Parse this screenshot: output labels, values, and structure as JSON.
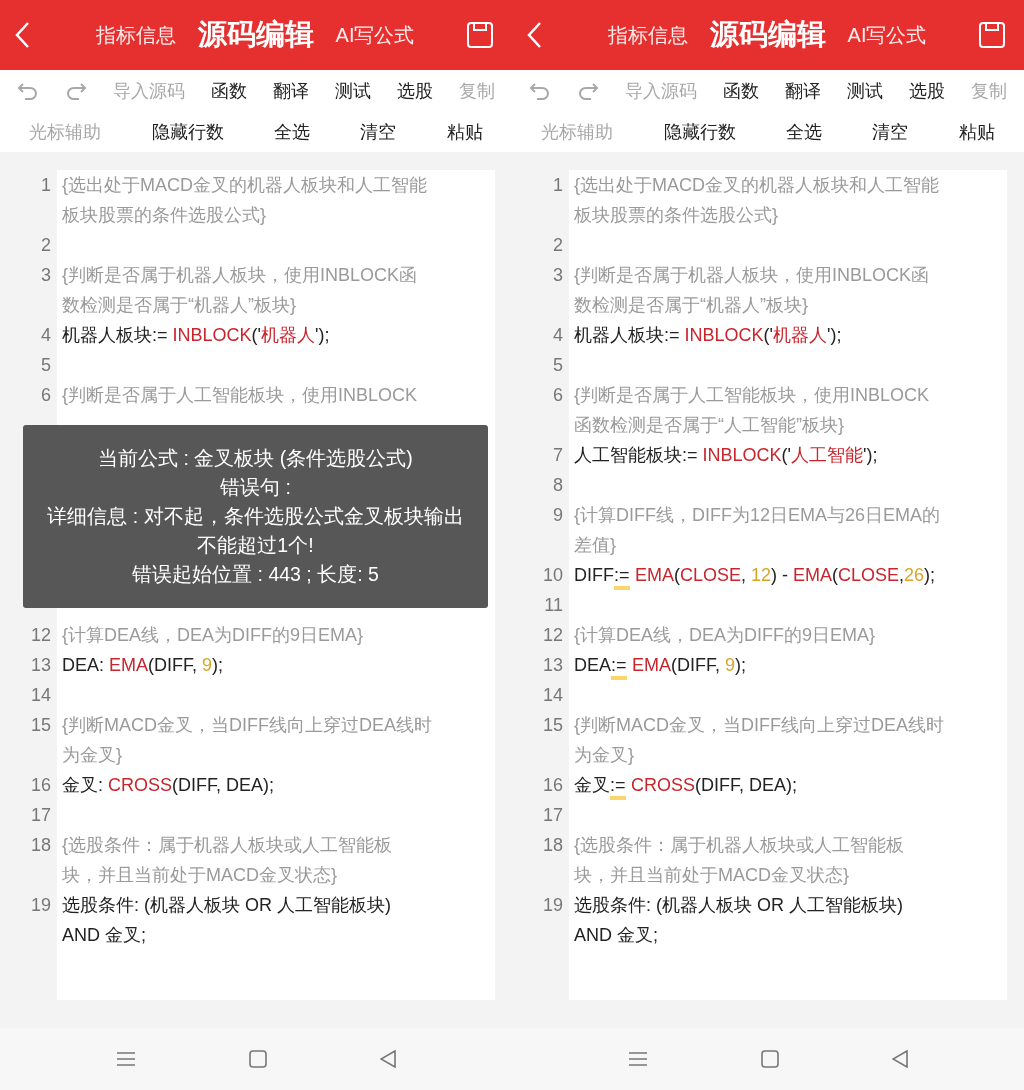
{
  "screens": [
    {
      "header": {
        "tabs": [
          {
            "label": "指标信息",
            "selected": false
          },
          {
            "label": "源码编辑",
            "selected": true
          },
          {
            "label": "AI写公式",
            "selected": false
          }
        ]
      },
      "toolbar": {
        "rows": [
          {
            "items": [
              {
                "kind": "undo",
                "disabled": true
              },
              {
                "kind": "redo",
                "disabled": true
              },
              {
                "kind": "text",
                "label": "导入源码",
                "disabled": true
              },
              {
                "kind": "text",
                "label": "函数",
                "disabled": false
              },
              {
                "kind": "text",
                "label": "翻译",
                "disabled": false
              },
              {
                "kind": "text",
                "label": "测试",
                "disabled": false
              },
              {
                "kind": "text",
                "label": "选股",
                "disabled": false
              },
              {
                "kind": "text",
                "label": "复制",
                "disabled": true
              }
            ]
          },
          {
            "items": [
              {
                "kind": "text",
                "label": "光标辅助",
                "disabled": true
              },
              {
                "kind": "text",
                "label": "隐藏行数",
                "disabled": false
              },
              {
                "kind": "text",
                "label": "全选",
                "disabled": false
              },
              {
                "kind": "text",
                "label": "清空",
                "disabled": false
              },
              {
                "kind": "text",
                "label": "粘贴",
                "disabled": false
              }
            ]
          }
        ]
      },
      "code": {
        "items": [
          {
            "kind": "line",
            "number": "1",
            "rows": [
              [
                {
                  "kind": "comment",
                  "text": "{选出处于MACD金叉的机器人板块和人工智能"
                }
              ],
              [
                {
                  "kind": "comment",
                  "text": "板块股票的条件选股公式}"
                }
              ]
            ]
          },
          {
            "kind": "line",
            "number": "2"
          },
          {
            "kind": "line",
            "number": "3",
            "rows": [
              [
                {
                  "kind": "comment",
                  "text": "{判断是否属于机器人板块，使用INBLOCK函"
                }
              ],
              [
                {
                  "kind": "comment",
                  "text": "数检测是否属于“机器人”板块}"
                }
              ]
            ]
          },
          {
            "kind": "line",
            "number": "4",
            "rows": [
              [
                {
                  "kind": "plain",
                  "text": "机器人板块:= "
                },
                {
                  "kind": "func",
                  "text": "INBLOCK"
                },
                {
                  "kind": "plain",
                  "text": "('"
                },
                {
                  "kind": "str",
                  "text": "机器人"
                },
                {
                  "kind": "plain",
                  "text": "');"
                }
              ]
            ]
          },
          {
            "kind": "line",
            "number": "5"
          },
          {
            "kind": "line",
            "number": "6",
            "rows": [
              [
                {
                  "kind": "comment",
                  "text": "{判断是否属于人工智能板块，使用INBLOCK"
                }
              ]
            ]
          },
          {
            "kind": "toast",
            "lines": [
              "当前公式 : 金叉板块 (条件选股公式)",
              "错误句 :",
              "详细信息 : 对不起，条件选股公式金叉板块输出不能超过1个!",
              "错误起始位置 : 443 ; 长度: 5"
            ]
          },
          {
            "kind": "line",
            "number": "12",
            "rows": [
              [
                {
                  "kind": "comment",
                  "text": "{计算DEA线，DEA为DIFF的9日EMA}"
                }
              ]
            ]
          },
          {
            "kind": "line",
            "number": "13",
            "rows": [
              [
                {
                  "kind": "plain",
                  "text": "DEA: "
                },
                {
                  "kind": "func",
                  "text": "EMA"
                },
                {
                  "kind": "plain",
                  "text": "(DIFF, "
                },
                {
                  "kind": "num",
                  "text": "9"
                },
                {
                  "kind": "plain",
                  "text": ");"
                }
              ]
            ]
          },
          {
            "kind": "line",
            "number": "14"
          },
          {
            "kind": "line",
            "number": "15",
            "rows": [
              [
                {
                  "kind": "comment",
                  "text": "{判断MACD金叉，当DIFF线向上穿过DEA线时"
                }
              ],
              [
                {
                  "kind": "comment",
                  "text": "为金叉}"
                }
              ]
            ]
          },
          {
            "kind": "line",
            "number": "16",
            "rows": [
              [
                {
                  "kind": "plain",
                  "text": "金叉: "
                },
                {
                  "kind": "func",
                  "text": "CROSS"
                },
                {
                  "kind": "plain",
                  "text": "(DIFF, DEA);"
                }
              ]
            ]
          },
          {
            "kind": "line",
            "number": "17"
          },
          {
            "kind": "line",
            "number": "18",
            "rows": [
              [
                {
                  "kind": "comment",
                  "text": "{选股条件：属于机器人板块或人工智能板"
                }
              ],
              [
                {
                  "kind": "comment",
                  "text": "块，并且当前处于MACD金叉状态}"
                }
              ]
            ]
          },
          {
            "kind": "line",
            "number": "19",
            "rows": [
              [
                {
                  "kind": "plain",
                  "text": "选股条件: (机器人板块 OR 人工智能板块)"
                }
              ],
              [
                {
                  "kind": "plain",
                  "text": "AND 金叉;"
                }
              ]
            ]
          }
        ]
      }
    },
    {
      "header": {
        "tabs": [
          {
            "label": "指标信息",
            "selected": false
          },
          {
            "label": "源码编辑",
            "selected": true
          },
          {
            "label": "AI写公式",
            "selected": false
          }
        ]
      },
      "toolbar": {
        "rows": [
          {
            "items": [
              {
                "kind": "undo",
                "disabled": true
              },
              {
                "kind": "redo",
                "disabled": true
              },
              {
                "kind": "text",
                "label": "导入源码",
                "disabled": true
              },
              {
                "kind": "text",
                "label": "函数",
                "disabled": false
              },
              {
                "kind": "text",
                "label": "翻译",
                "disabled": false
              },
              {
                "kind": "text",
                "label": "测试",
                "disabled": false
              },
              {
                "kind": "text",
                "label": "选股",
                "disabled": false
              },
              {
                "kind": "text",
                "label": "复制",
                "disabled": true
              }
            ]
          },
          {
            "items": [
              {
                "kind": "text",
                "label": "光标辅助",
                "disabled": true
              },
              {
                "kind": "text",
                "label": "隐藏行数",
                "disabled": false
              },
              {
                "kind": "text",
                "label": "全选",
                "disabled": false
              },
              {
                "kind": "text",
                "label": "清空",
                "disabled": false
              },
              {
                "kind": "text",
                "label": "粘贴",
                "disabled": false
              }
            ]
          }
        ]
      },
      "code": {
        "items": [
          {
            "kind": "line",
            "number": "1",
            "rows": [
              [
                {
                  "kind": "comment",
                  "text": "{选出处于MACD金叉的机器人板块和人工智能"
                }
              ],
              [
                {
                  "kind": "comment",
                  "text": "板块股票的条件选股公式}"
                }
              ]
            ]
          },
          {
            "kind": "line",
            "number": "2"
          },
          {
            "kind": "line",
            "number": "3",
            "rows": [
              [
                {
                  "kind": "comment",
                  "text": "{判断是否属于机器人板块，使用INBLOCK函"
                }
              ],
              [
                {
                  "kind": "comment",
                  "text": "数检测是否属于“机器人”板块}"
                }
              ]
            ]
          },
          {
            "kind": "line",
            "number": "4",
            "rows": [
              [
                {
                  "kind": "plain",
                  "text": "机器人板块:= "
                },
                {
                  "kind": "func",
                  "text": "INBLOCK"
                },
                {
                  "kind": "plain",
                  "text": "('"
                },
                {
                  "kind": "str",
                  "text": "机器人"
                },
                {
                  "kind": "plain",
                  "text": "');"
                }
              ]
            ]
          },
          {
            "kind": "line",
            "number": "5"
          },
          {
            "kind": "line",
            "number": "6",
            "rows": [
              [
                {
                  "kind": "comment",
                  "text": "{判断是否属于人工智能板块，使用INBLOCK"
                }
              ],
              [
                {
                  "kind": "comment",
                  "text": "函数检测是否属于“人工智能”板块}"
                }
              ]
            ]
          },
          {
            "kind": "line",
            "number": "7",
            "rows": [
              [
                {
                  "kind": "plain",
                  "text": "人工智能板块:= "
                },
                {
                  "kind": "func",
                  "text": "INBLOCK"
                },
                {
                  "kind": "plain",
                  "text": "('"
                },
                {
                  "kind": "str",
                  "text": "人工智能"
                },
                {
                  "kind": "plain",
                  "text": "');"
                }
              ]
            ]
          },
          {
            "kind": "line",
            "number": "8"
          },
          {
            "kind": "line",
            "number": "9",
            "rows": [
              [
                {
                  "kind": "comment",
                  "text": "{计算DIFF线，DIFF为12日EMA与26日EMA的"
                }
              ],
              [
                {
                  "kind": "comment",
                  "text": "差值}"
                }
              ]
            ]
          },
          {
            "kind": "line",
            "number": "10",
            "rows": [
              [
                {
                  "kind": "plain",
                  "text": "DIFF"
                },
                {
                  "kind": "plain",
                  "text": ":=",
                  "highlight": true
                },
                {
                  "kind": "func",
                  "text": "EMA"
                },
                {
                  "kind": "plain",
                  "text": "("
                },
                {
                  "kind": "func",
                  "text": "CLOSE"
                },
                {
                  "kind": "plain",
                  "text": ", "
                },
                {
                  "kind": "num",
                  "text": "12"
                },
                {
                  "kind": "plain",
                  "text": ") - "
                },
                {
                  "kind": "func",
                  "text": "EMA"
                },
                {
                  "kind": "plain",
                  "text": "("
                },
                {
                  "kind": "func",
                  "text": "CLOSE"
                },
                {
                  "kind": "plain",
                  "text": ","
                },
                {
                  "kind": "num",
                  "text": "26"
                },
                {
                  "kind": "plain",
                  "text": ");"
                }
              ]
            ]
          },
          {
            "kind": "line",
            "number": "11"
          },
          {
            "kind": "line",
            "number": "12",
            "rows": [
              [
                {
                  "kind": "comment",
                  "text": "{计算DEA线，DEA为DIFF的9日EMA}"
                }
              ]
            ]
          },
          {
            "kind": "line",
            "number": "13",
            "rows": [
              [
                {
                  "kind": "plain",
                  "text": "DEA"
                },
                {
                  "kind": "plain",
                  "text": ":=",
                  "highlight": true
                },
                {
                  "kind": "func",
                  "text": "EMA"
                },
                {
                  "kind": "plain",
                  "text": "(DIFF, "
                },
                {
                  "kind": "num",
                  "text": "9"
                },
                {
                  "kind": "plain",
                  "text": ");"
                }
              ]
            ]
          },
          {
            "kind": "line",
            "number": "14"
          },
          {
            "kind": "line",
            "number": "15",
            "rows": [
              [
                {
                  "kind": "comment",
                  "text": "{判断MACD金叉，当DIFF线向上穿过DEA线时"
                }
              ],
              [
                {
                  "kind": "comment",
                  "text": "为金叉}"
                }
              ]
            ]
          },
          {
            "kind": "line",
            "number": "16",
            "rows": [
              [
                {
                  "kind": "plain",
                  "text": "金叉"
                },
                {
                  "kind": "plain",
                  "text": ":=",
                  "highlight": true
                },
                {
                  "kind": "func",
                  "text": "CROSS"
                },
                {
                  "kind": "plain",
                  "text": "(DIFF, DEA);"
                }
              ]
            ]
          },
          {
            "kind": "line",
            "number": "17"
          },
          {
            "kind": "line",
            "number": "18",
            "rows": [
              [
                {
                  "kind": "comment",
                  "text": "{选股条件：属于机器人板块或人工智能板"
                }
              ],
              [
                {
                  "kind": "comment",
                  "text": "块，并且当前处于MACD金叉状态}"
                }
              ]
            ]
          },
          {
            "kind": "line",
            "number": "19",
            "rows": [
              [
                {
                  "kind": "plain",
                  "text": "选股条件: (机器人板块 OR 人工智能板块)"
                }
              ],
              [
                {
                  "kind": "plain",
                  "text": "AND 金叉;"
                }
              ]
            ]
          }
        ]
      }
    }
  ]
}
